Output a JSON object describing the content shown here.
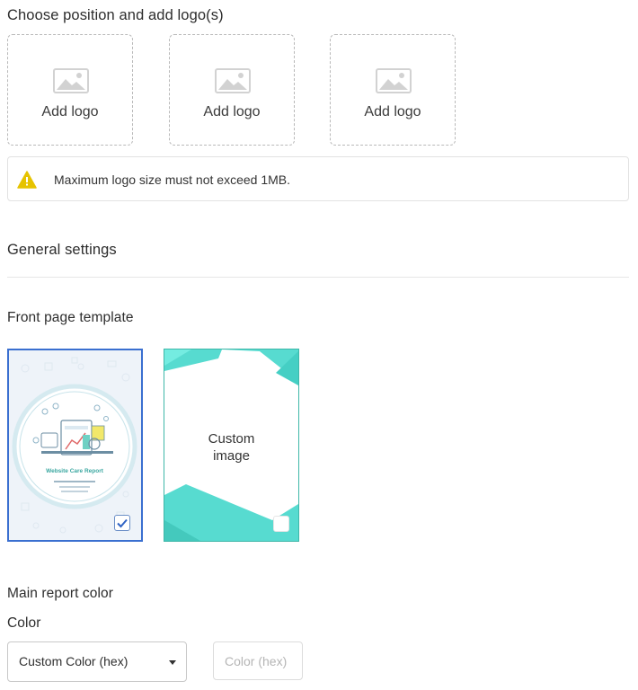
{
  "logos": {
    "heading": "Choose position and add logo(s)",
    "slots": [
      {
        "label": "Add logo",
        "icon": "image-placeholder-icon"
      },
      {
        "label": "Add logo",
        "icon": "image-placeholder-icon"
      },
      {
        "label": "Add logo",
        "icon": "image-placeholder-icon"
      }
    ],
    "notice": "Maximum logo size must not exceed 1MB.",
    "notice_icon": "warning-icon",
    "warning_color": "#e6c300"
  },
  "general": {
    "heading": "General settings"
  },
  "front_page": {
    "heading": "Front page template",
    "templates": [
      {
        "name": "Website Care Report",
        "selected": true
      },
      {
        "name": "Custom image",
        "label_line1": "Custom",
        "label_line2": "image",
        "selected": false
      }
    ],
    "selected_border_color": "#3a6fd0",
    "custom_accent_color": "#4fd6c8"
  },
  "report_color": {
    "heading": "Main report color",
    "color_label": "Color",
    "select": {
      "selected": "Custom Color (hex)"
    },
    "hex_input": {
      "placeholder": "Color (hex)",
      "value": ""
    }
  }
}
